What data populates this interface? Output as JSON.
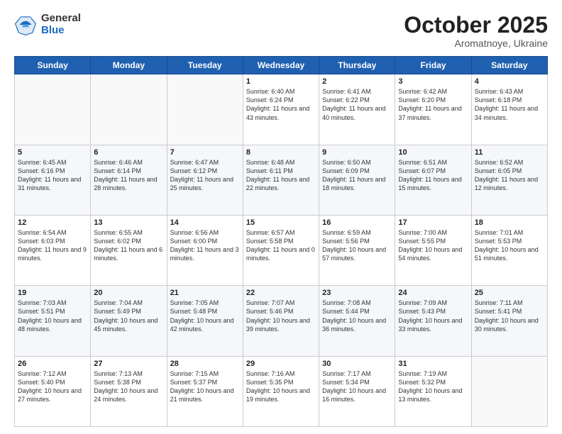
{
  "logo": {
    "general": "General",
    "blue": "Blue"
  },
  "header": {
    "month": "October 2025",
    "location": "Aromatnoye, Ukraine"
  },
  "weekdays": [
    "Sunday",
    "Monday",
    "Tuesday",
    "Wednesday",
    "Thursday",
    "Friday",
    "Saturday"
  ],
  "weeks": [
    [
      {
        "day": "",
        "info": ""
      },
      {
        "day": "",
        "info": ""
      },
      {
        "day": "",
        "info": ""
      },
      {
        "day": "1",
        "info": "Sunrise: 6:40 AM\nSunset: 6:24 PM\nDaylight: 11 hours\nand 43 minutes."
      },
      {
        "day": "2",
        "info": "Sunrise: 6:41 AM\nSunset: 6:22 PM\nDaylight: 11 hours\nand 40 minutes."
      },
      {
        "day": "3",
        "info": "Sunrise: 6:42 AM\nSunset: 6:20 PM\nDaylight: 11 hours\nand 37 minutes."
      },
      {
        "day": "4",
        "info": "Sunrise: 6:43 AM\nSunset: 6:18 PM\nDaylight: 11 hours\nand 34 minutes."
      }
    ],
    [
      {
        "day": "5",
        "info": "Sunrise: 6:45 AM\nSunset: 6:16 PM\nDaylight: 11 hours\nand 31 minutes."
      },
      {
        "day": "6",
        "info": "Sunrise: 6:46 AM\nSunset: 6:14 PM\nDaylight: 11 hours\nand 28 minutes."
      },
      {
        "day": "7",
        "info": "Sunrise: 6:47 AM\nSunset: 6:12 PM\nDaylight: 11 hours\nand 25 minutes."
      },
      {
        "day": "8",
        "info": "Sunrise: 6:48 AM\nSunset: 6:11 PM\nDaylight: 11 hours\nand 22 minutes."
      },
      {
        "day": "9",
        "info": "Sunrise: 6:50 AM\nSunset: 6:09 PM\nDaylight: 11 hours\nand 18 minutes."
      },
      {
        "day": "10",
        "info": "Sunrise: 6:51 AM\nSunset: 6:07 PM\nDaylight: 11 hours\nand 15 minutes."
      },
      {
        "day": "11",
        "info": "Sunrise: 6:52 AM\nSunset: 6:05 PM\nDaylight: 11 hours\nand 12 minutes."
      }
    ],
    [
      {
        "day": "12",
        "info": "Sunrise: 6:54 AM\nSunset: 6:03 PM\nDaylight: 11 hours\nand 9 minutes."
      },
      {
        "day": "13",
        "info": "Sunrise: 6:55 AM\nSunset: 6:02 PM\nDaylight: 11 hours\nand 6 minutes."
      },
      {
        "day": "14",
        "info": "Sunrise: 6:56 AM\nSunset: 6:00 PM\nDaylight: 11 hours\nand 3 minutes."
      },
      {
        "day": "15",
        "info": "Sunrise: 6:57 AM\nSunset: 5:58 PM\nDaylight: 11 hours\nand 0 minutes."
      },
      {
        "day": "16",
        "info": "Sunrise: 6:59 AM\nSunset: 5:56 PM\nDaylight: 10 hours\nand 57 minutes."
      },
      {
        "day": "17",
        "info": "Sunrise: 7:00 AM\nSunset: 5:55 PM\nDaylight: 10 hours\nand 54 minutes."
      },
      {
        "day": "18",
        "info": "Sunrise: 7:01 AM\nSunset: 5:53 PM\nDaylight: 10 hours\nand 51 minutes."
      }
    ],
    [
      {
        "day": "19",
        "info": "Sunrise: 7:03 AM\nSunset: 5:51 PM\nDaylight: 10 hours\nand 48 minutes."
      },
      {
        "day": "20",
        "info": "Sunrise: 7:04 AM\nSunset: 5:49 PM\nDaylight: 10 hours\nand 45 minutes."
      },
      {
        "day": "21",
        "info": "Sunrise: 7:05 AM\nSunset: 5:48 PM\nDaylight: 10 hours\nand 42 minutes."
      },
      {
        "day": "22",
        "info": "Sunrise: 7:07 AM\nSunset: 5:46 PM\nDaylight: 10 hours\nand 39 minutes."
      },
      {
        "day": "23",
        "info": "Sunrise: 7:08 AM\nSunset: 5:44 PM\nDaylight: 10 hours\nand 36 minutes."
      },
      {
        "day": "24",
        "info": "Sunrise: 7:09 AM\nSunset: 5:43 PM\nDaylight: 10 hours\nand 33 minutes."
      },
      {
        "day": "25",
        "info": "Sunrise: 7:11 AM\nSunset: 5:41 PM\nDaylight: 10 hours\nand 30 minutes."
      }
    ],
    [
      {
        "day": "26",
        "info": "Sunrise: 7:12 AM\nSunset: 5:40 PM\nDaylight: 10 hours\nand 27 minutes."
      },
      {
        "day": "27",
        "info": "Sunrise: 7:13 AM\nSunset: 5:38 PM\nDaylight: 10 hours\nand 24 minutes."
      },
      {
        "day": "28",
        "info": "Sunrise: 7:15 AM\nSunset: 5:37 PM\nDaylight: 10 hours\nand 21 minutes."
      },
      {
        "day": "29",
        "info": "Sunrise: 7:16 AM\nSunset: 5:35 PM\nDaylight: 10 hours\nand 19 minutes."
      },
      {
        "day": "30",
        "info": "Sunrise: 7:17 AM\nSunset: 5:34 PM\nDaylight: 10 hours\nand 16 minutes."
      },
      {
        "day": "31",
        "info": "Sunrise: 7:19 AM\nSunset: 5:32 PM\nDaylight: 10 hours\nand 13 minutes."
      },
      {
        "day": "",
        "info": ""
      }
    ]
  ]
}
